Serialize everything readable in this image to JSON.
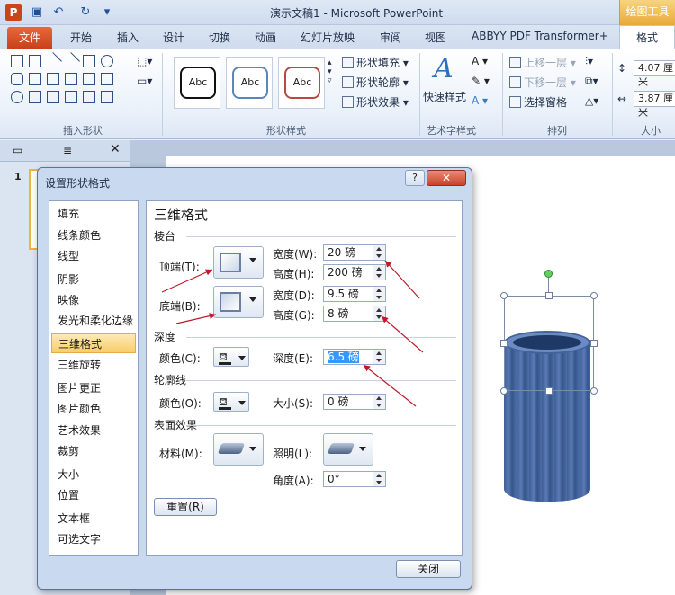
{
  "titlebar": {
    "app_title": "演示文稿1 - Microsoft PowerPoint",
    "tool_tab": "绘图工具"
  },
  "ribbon_tabs": [
    "文件",
    "开始",
    "插入",
    "设计",
    "切换",
    "动画",
    "幻灯片放映",
    "审阅",
    "视图",
    "ABBYY PDF Transformer+",
    "格式"
  ],
  "ribbon": {
    "group_insert_shapes": "插入形状",
    "group_shape_styles": "形状样式",
    "group_wordart": "艺术字样式",
    "group_arrange": "排列",
    "group_size": "大小",
    "style_sample": "Abc",
    "shape_fill": "形状填充",
    "shape_outline": "形状轮廓",
    "shape_effects": "形状效果",
    "quick_styles": "快速样式",
    "bring_forward": "上移一层",
    "send_backward": "下移一层",
    "selection_pane": "选择窗格",
    "height_value": "4.07 厘米",
    "width_value": "3.87 厘米"
  },
  "slide_pane": {
    "slide_number": "1"
  },
  "dialog": {
    "title": "设置形状格式",
    "help": "?",
    "nav": [
      "填充",
      "线条颜色",
      "线型",
      "阴影",
      "映像",
      "发光和柔化边缘",
      "三维格式",
      "三维旋转",
      "图片更正",
      "图片颜色",
      "艺术效果",
      "裁剪",
      "大小",
      "位置",
      "文本框",
      "可选文字"
    ],
    "section_title": "三维格式",
    "bevel_head": "棱台",
    "top_label": "顶端(T):",
    "bottom_label": "底端(B):",
    "width_label": "宽度(W):",
    "height_label": "高度(H):",
    "width2_label": "宽度(D):",
    "height2_label": "高度(G):",
    "top_width": "20 磅",
    "top_height": "200 磅",
    "bottom_width": "9.5 磅",
    "bottom_height": "8 磅",
    "depth_head": "深度",
    "depth_color_label": "颜色(C):",
    "depth_label": "深度(E):",
    "depth_value": "6.5 磅",
    "contour_head": "轮廓线",
    "contour_color_label": "颜色(O):",
    "size_label": "大小(S):",
    "size_value": "0 磅",
    "surface_head": "表面效果",
    "material_label": "材料(M):",
    "lighting_label": "照明(L):",
    "angle_label": "角度(A):",
    "angle_value": "0°",
    "reset_button": "重置(R)",
    "close_button": "关闭"
  },
  "colors": {
    "accent": "#c8401a",
    "selection": "#f7cd6a",
    "cylinder": "#4d6ea8",
    "arrow": "#c01a2a"
  }
}
